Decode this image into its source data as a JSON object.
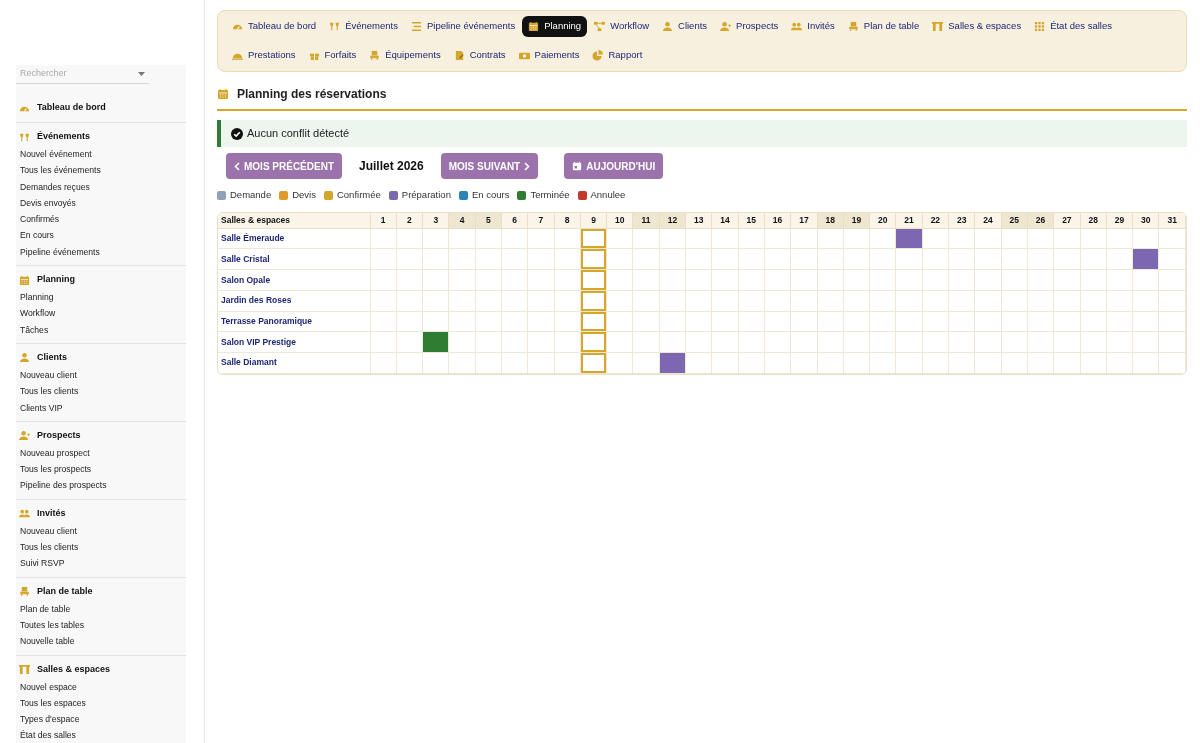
{
  "sidebar": {
    "search": {
      "placeholder": "Rechercher"
    },
    "sections": [
      {
        "title": "Tableau de bord"
      },
      {
        "title": "Événements",
        "items": [
          "Nouvel événement",
          "Tous les événements",
          "Demandes reçues",
          "Devis envoyés",
          "Confirmés",
          "En cours",
          "Pipeline événements"
        ]
      },
      {
        "title": "Planning",
        "items": [
          "Planning",
          "Workflow",
          "Tâches"
        ]
      },
      {
        "title": "Clients",
        "items": [
          "Nouveau client",
          "Tous les clients",
          "Clients VIP"
        ]
      },
      {
        "title": "Prospects",
        "items": [
          "Nouveau prospect",
          "Tous les prospects",
          "Pipeline des prospects"
        ]
      },
      {
        "title": "Invités",
        "items": [
          "Nouveau client",
          "Tous les clients",
          "Suivi RSVP"
        ]
      },
      {
        "title": "Plan de table",
        "items": [
          "Plan de table",
          "Toutes les tables",
          "Nouvelle table"
        ]
      },
      {
        "title": "Salles & espaces",
        "items": [
          "Nouvel espace",
          "Tous les espaces",
          "Types d'espace",
          "État des salles"
        ]
      }
    ]
  },
  "tabs": [
    {
      "label": "Tableau de bord",
      "selected": false
    },
    {
      "label": "Événements",
      "selected": false
    },
    {
      "label": "Pipeline événements",
      "selected": false
    },
    {
      "label": "Planning",
      "selected": true
    },
    {
      "label": "Workflow",
      "selected": false
    },
    {
      "label": "Clients",
      "selected": false
    },
    {
      "label": "Prospects",
      "selected": false
    },
    {
      "label": "Invités",
      "selected": false
    },
    {
      "label": "Plan de table",
      "selected": false
    },
    {
      "label": "Salles & espaces",
      "selected": false
    },
    {
      "label": "État des salles",
      "selected": false
    },
    {
      "label": "Prestations",
      "selected": false
    },
    {
      "label": "Forfaits",
      "selected": false
    },
    {
      "label": "Équipements",
      "selected": false
    },
    {
      "label": "Contrats",
      "selected": false
    },
    {
      "label": "Paiements",
      "selected": false
    },
    {
      "label": "Rapport",
      "selected": false
    }
  ],
  "page_title": "Planning des réservations",
  "alert": "Aucun conflit détecté",
  "nav": {
    "previous": "MOIS PRÉCÉDENT",
    "month": "Juillet 2026",
    "next": "MOIS SUIVANT",
    "today": "AUJOURD'HUI"
  },
  "legend": [
    {
      "label": "Demande",
      "color": "#8fa3b8"
    },
    {
      "label": "Devis",
      "color": "#e09a2a"
    },
    {
      "label": "Confirmée",
      "color": "#d4a72c"
    },
    {
      "label": "Préparation",
      "color": "#7b68b0"
    },
    {
      "label": "En cours",
      "color": "#2a86b8"
    },
    {
      "label": "Terminée",
      "color": "#2e7d32"
    },
    {
      "label": "Annulee",
      "color": "#c0392b"
    }
  ],
  "table": {
    "corner": "Salles & espaces",
    "days": [
      {
        "label": "1",
        "weekend": false,
        "today": false
      },
      {
        "label": "2",
        "weekend": false,
        "today": false
      },
      {
        "label": "3",
        "weekend": false,
        "today": false
      },
      {
        "label": "4",
        "weekend": true,
        "today": false
      },
      {
        "label": "5",
        "weekend": true,
        "today": false
      },
      {
        "label": "6",
        "weekend": false,
        "today": false
      },
      {
        "label": "7",
        "weekend": false,
        "today": false
      },
      {
        "label": "8",
        "weekend": false,
        "today": false
      },
      {
        "label": "9",
        "weekend": false,
        "today": true
      },
      {
        "label": "10",
        "weekend": false,
        "today": false
      },
      {
        "label": "11",
        "weekend": true,
        "today": false
      },
      {
        "label": "12",
        "weekend": true,
        "today": false
      },
      {
        "label": "13",
        "weekend": false,
        "today": false
      },
      {
        "label": "14",
        "weekend": false,
        "today": false
      },
      {
        "label": "15",
        "weekend": false,
        "today": false
      },
      {
        "label": "16",
        "weekend": false,
        "today": false
      },
      {
        "label": "17",
        "weekend": false,
        "today": false
      },
      {
        "label": "18",
        "weekend": true,
        "today": false
      },
      {
        "label": "19",
        "weekend": true,
        "today": false
      },
      {
        "label": "20",
        "weekend": false,
        "today": false
      },
      {
        "label": "21",
        "weekend": false,
        "today": false
      },
      {
        "label": "22",
        "weekend": false,
        "today": false
      },
      {
        "label": "23",
        "weekend": false,
        "today": false
      },
      {
        "label": "24",
        "weekend": false,
        "today": false
      },
      {
        "label": "25",
        "weekend": true,
        "today": false
      },
      {
        "label": "26",
        "weekend": true,
        "today": false
      },
      {
        "label": "27",
        "weekend": false,
        "today": false
      },
      {
        "label": "28",
        "weekend": false,
        "today": false
      },
      {
        "label": "29",
        "weekend": false,
        "today": false
      },
      {
        "label": "30",
        "weekend": false,
        "today": false
      },
      {
        "label": "31",
        "weekend": false,
        "today": false
      }
    ],
    "rows": [
      {
        "name": "Salle Émeraude",
        "cells": [
          {
            "booked": false
          },
          {
            "booked": false
          },
          {
            "booked": false
          },
          {
            "booked": false
          },
          {
            "booked": false
          },
          {
            "booked": false
          },
          {
            "booked": false
          },
          {
            "booked": false
          },
          {
            "booked": false
          },
          {
            "booked": false
          },
          {
            "booked": false
          },
          {
            "booked": false
          },
          {
            "booked": false
          },
          {
            "booked": false
          },
          {
            "booked": false
          },
          {
            "booked": false
          },
          {
            "booked": false
          },
          {
            "booked": false
          },
          {
            "booked": false
          },
          {
            "booked": false
          },
          {
            "booked": true,
            "color": "#7b68b0"
          },
          {
            "booked": false
          },
          {
            "booked": false
          },
          {
            "booked": false
          },
          {
            "booked": false
          },
          {
            "booked": false
          },
          {
            "booked": false
          },
          {
            "booked": false
          },
          {
            "booked": false
          },
          {
            "booked": false
          },
          {
            "booked": false
          }
        ]
      },
      {
        "name": "Salle Cristal",
        "cells": [
          {
            "booked": false
          },
          {
            "booked": false
          },
          {
            "booked": false
          },
          {
            "booked": false
          },
          {
            "booked": false
          },
          {
            "booked": false
          },
          {
            "booked": false
          },
          {
            "booked": false
          },
          {
            "booked": false
          },
          {
            "booked": false
          },
          {
            "booked": false
          },
          {
            "booked": false
          },
          {
            "booked": false
          },
          {
            "booked": false
          },
          {
            "booked": false
          },
          {
            "booked": false
          },
          {
            "booked": false
          },
          {
            "booked": false
          },
          {
            "booked": false
          },
          {
            "booked": false
          },
          {
            "booked": false
          },
          {
            "booked": false
          },
          {
            "booked": false
          },
          {
            "booked": false
          },
          {
            "booked": false
          },
          {
            "booked": false
          },
          {
            "booked": false
          },
          {
            "booked": false
          },
          {
            "booked": false
          },
          {
            "booked": true,
            "color": "#7b68b0"
          },
          {
            "booked": false
          }
        ]
      },
      {
        "name": "Salon Opale",
        "cells": [
          {
            "booked": false
          },
          {
            "booked": false
          },
          {
            "booked": false
          },
          {
            "booked": false
          },
          {
            "booked": false
          },
          {
            "booked": false
          },
          {
            "booked": false
          },
          {
            "booked": false
          },
          {
            "booked": false
          },
          {
            "booked": false
          },
          {
            "booked": false
          },
          {
            "booked": false
          },
          {
            "booked": false
          },
          {
            "booked": false
          },
          {
            "booked": false
          },
          {
            "booked": false
          },
          {
            "booked": false
          },
          {
            "booked": false
          },
          {
            "booked": false
          },
          {
            "booked": false
          },
          {
            "booked": false
          },
          {
            "booked": false
          },
          {
            "booked": false
          },
          {
            "booked": false
          },
          {
            "booked": false
          },
          {
            "booked": false
          },
          {
            "booked": false
          },
          {
            "booked": false
          },
          {
            "booked": false
          },
          {
            "booked": false
          },
          {
            "booked": false
          }
        ]
      },
      {
        "name": "Jardin des Roses",
        "cells": [
          {
            "booked": false
          },
          {
            "booked": false
          },
          {
            "booked": false
          },
          {
            "booked": false
          },
          {
            "booked": false
          },
          {
            "booked": false
          },
          {
            "booked": false
          },
          {
            "booked": false
          },
          {
            "booked": false
          },
          {
            "booked": false
          },
          {
            "booked": false
          },
          {
            "booked": false
          },
          {
            "booked": false
          },
          {
            "booked": false
          },
          {
            "booked": false
          },
          {
            "booked": false
          },
          {
            "booked": false
          },
          {
            "booked": false
          },
          {
            "booked": false
          },
          {
            "booked": false
          },
          {
            "booked": false
          },
          {
            "booked": false
          },
          {
            "booked": false
          },
          {
            "booked": false
          },
          {
            "booked": false
          },
          {
            "booked": false
          },
          {
            "booked": false
          },
          {
            "booked": false
          },
          {
            "booked": false
          },
          {
            "booked": false
          },
          {
            "booked": false
          }
        ]
      },
      {
        "name": "Terrasse Panoramique",
        "cells": [
          {
            "booked": false
          },
          {
            "booked": false
          },
          {
            "booked": false
          },
          {
            "booked": false
          },
          {
            "booked": false
          },
          {
            "booked": false
          },
          {
            "booked": false
          },
          {
            "booked": false
          },
          {
            "booked": false
          },
          {
            "booked": false
          },
          {
            "booked": false
          },
          {
            "booked": false
          },
          {
            "booked": false
          },
          {
            "booked": false
          },
          {
            "booked": false
          },
          {
            "booked": false
          },
          {
            "booked": false
          },
          {
            "booked": false
          },
          {
            "booked": false
          },
          {
            "booked": false
          },
          {
            "booked": false
          },
          {
            "booked": false
          },
          {
            "booked": false
          },
          {
            "booked": false
          },
          {
            "booked": false
          },
          {
            "booked": false
          },
          {
            "booked": false
          },
          {
            "booked": false
          },
          {
            "booked": false
          },
          {
            "booked": false
          },
          {
            "booked": false
          }
        ]
      },
      {
        "name": "Salon VIP Prestige",
        "cells": [
          {
            "booked": false
          },
          {
            "booked": false
          },
          {
            "booked": true,
            "color": "#2e7d32"
          },
          {
            "booked": false
          },
          {
            "booked": false
          },
          {
            "booked": false
          },
          {
            "booked": false
          },
          {
            "booked": false
          },
          {
            "booked": false
          },
          {
            "booked": false
          },
          {
            "booked": false
          },
          {
            "booked": false
          },
          {
            "booked": false
          },
          {
            "booked": false
          },
          {
            "booked": false
          },
          {
            "booked": false
          },
          {
            "booked": false
          },
          {
            "booked": false
          },
          {
            "booked": false
          },
          {
            "booked": false
          },
          {
            "booked": false
          },
          {
            "booked": false
          },
          {
            "booked": false
          },
          {
            "booked": false
          },
          {
            "booked": false
          },
          {
            "booked": false
          },
          {
            "booked": false
          },
          {
            "booked": false
          },
          {
            "booked": false
          },
          {
            "booked": false
          },
          {
            "booked": false
          }
        ]
      },
      {
        "name": "Salle Diamant",
        "cells": [
          {
            "booked": false
          },
          {
            "booked": false
          },
          {
            "booked": false
          },
          {
            "booked": false
          },
          {
            "booked": false
          },
          {
            "booked": false
          },
          {
            "booked": false
          },
          {
            "booked": false
          },
          {
            "booked": false
          },
          {
            "booked": false
          },
          {
            "booked": false
          },
          {
            "booked": true,
            "color": "#7b68b0"
          },
          {
            "booked": false
          },
          {
            "booked": false
          },
          {
            "booked": false
          },
          {
            "booked": false
          },
          {
            "booked": false
          },
          {
            "booked": false
          },
          {
            "booked": false
          },
          {
            "booked": false
          },
          {
            "booked": false
          },
          {
            "booked": false
          },
          {
            "booked": false
          },
          {
            "booked": false
          },
          {
            "booked": false
          },
          {
            "booked": false
          },
          {
            "booked": false
          },
          {
            "booked": false
          },
          {
            "booked": false
          },
          {
            "booked": false
          },
          {
            "booked": false
          }
        ]
      }
    ]
  }
}
